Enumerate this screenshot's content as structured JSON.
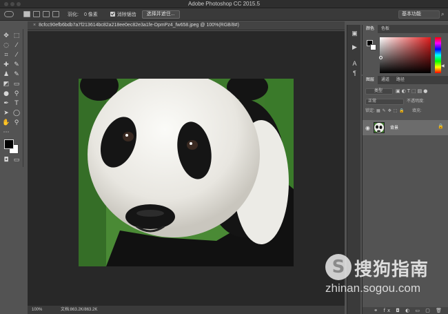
{
  "window": {
    "title": "Adobe Photoshop CC 2015.5"
  },
  "options_bar": {
    "feather_label": "羽化:",
    "feather_value": "0 像素",
    "antialias_label": "消除锯齿",
    "select_mask_button": "选择并遮住...",
    "workspace": "基本功能"
  },
  "document": {
    "tab_title": "8cfcc90efb6bdb7a7f213614bc82a218ee0ec82e3a1fe-DpmPz4_fw658.jpeg @ 100%(RGB/8#)",
    "close_glyph": "×",
    "zoom": "100%",
    "doc_info": "文档:863.2K/863.2K"
  },
  "color_panel": {
    "tabs": [
      "颜色",
      "色板"
    ],
    "foreground": "#000000",
    "background": "#ffffff"
  },
  "layers_panel": {
    "tabs": [
      "图层",
      "通道",
      "路径"
    ],
    "kind_filter": "类型",
    "blend_mode": "正常",
    "opacity_label": "不透明度:",
    "lock_label": "锁定:",
    "fill_label": "填充:",
    "layer_name": "背景"
  },
  "watermark": {
    "logo": "S",
    "brand": "搜狗指南",
    "url": "zhinan.sogou.com"
  }
}
